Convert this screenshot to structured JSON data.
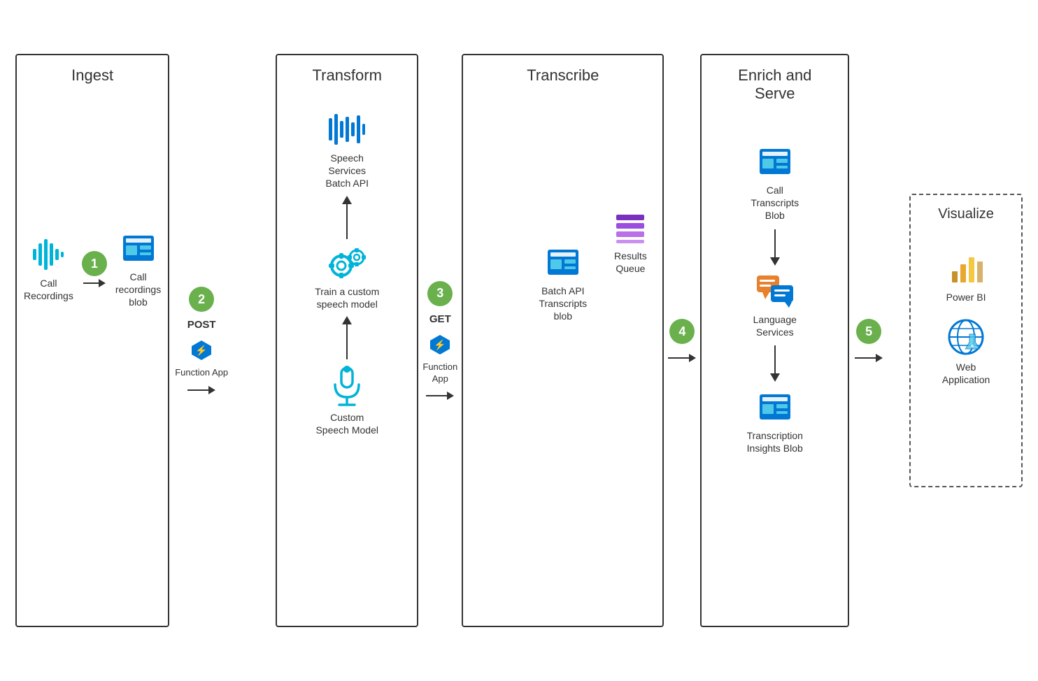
{
  "sections": {
    "ingest": {
      "title": "Ingest",
      "call_recordings_label": "Call\nRecordings",
      "call_recordings_blob_label": "Call\nrecordings\nblob"
    },
    "transform": {
      "title": "Transform",
      "speech_services_label": "Speech\nServices\nBatch API",
      "train_label": "Train a custom\nspeech model",
      "custom_speech_label": "Custom\nSpeech Model",
      "post_label": "POST",
      "function_app_label": "Function App"
    },
    "transcribe": {
      "title": "Transcribe",
      "get_label": "GET",
      "function_app_label": "Function\nApp",
      "batch_api_label": "Batch API\nTranscripts\nblob",
      "results_queue_label": "Results\nQueue"
    },
    "enrich": {
      "title": "Enrich and\nServe",
      "call_transcripts_label": "Call\nTranscripts\nBlob",
      "language_services_label": "Language\nServices",
      "transcription_insights_label": "Transcription\nInsights Blob"
    },
    "visualize": {
      "title": "Visualize",
      "power_bi_label": "Power BI",
      "web_app_label": "Web\nApplication"
    }
  },
  "steps": {
    "step1": "1",
    "step2": "2",
    "step3": "3",
    "step4": "4",
    "step5": "5"
  },
  "colors": {
    "azure_blue": "#0078d4",
    "azure_blue_dark": "#005a9e",
    "teal": "#00b4d8",
    "green_badge": "#6ab04c",
    "orange": "#e8812d",
    "purple": "#7b2fbe",
    "gold": "#c8922a",
    "border": "#333333",
    "dashed_border": "#555555"
  }
}
